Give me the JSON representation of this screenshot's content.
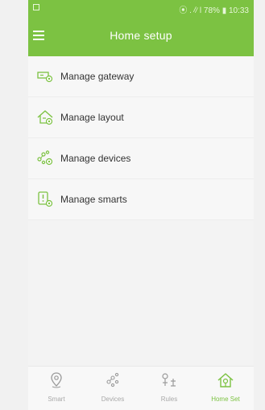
{
  "status_bar": {
    "right_text": "⦿ .∥l 78% ▮ 10:33"
  },
  "app_bar": {
    "title": "Home setup"
  },
  "menu": [
    {
      "label": "Manage gateway",
      "icon": "gateway-icon"
    },
    {
      "label": "Manage layout",
      "icon": "layout-icon"
    },
    {
      "label": "Manage devices",
      "icon": "devices-icon"
    },
    {
      "label": "Manage smarts",
      "icon": "smarts-icon"
    }
  ],
  "bottom_nav": {
    "tabs": [
      {
        "label": "Smart",
        "icon": "location-pin-icon",
        "active": false
      },
      {
        "label": "Devices",
        "icon": "devices-icon",
        "active": false
      },
      {
        "label": "Rules",
        "icon": "rules-icon",
        "active": false
      },
      {
        "label": "Home Set",
        "icon": "home-icon",
        "active": true
      }
    ]
  },
  "colors": {
    "accent": "#7cc242",
    "inactive": "#a8a8a8"
  }
}
